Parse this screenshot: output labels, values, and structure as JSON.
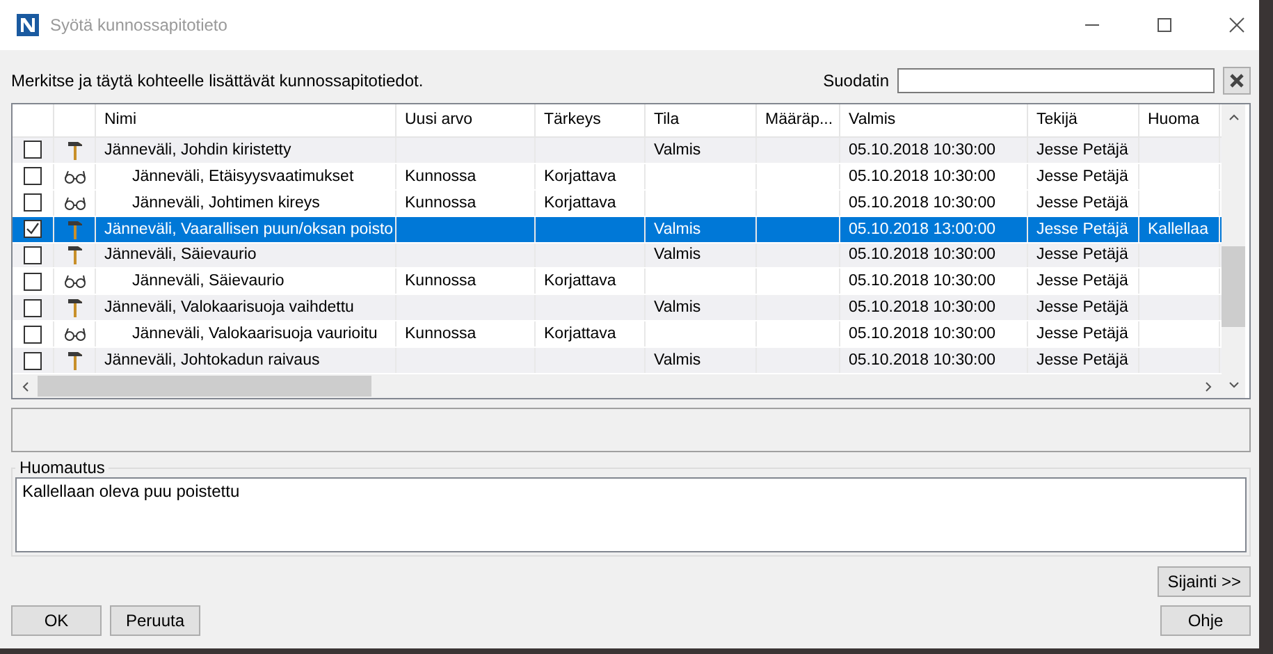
{
  "window": {
    "title": "Syötä kunnossapitotieto"
  },
  "instruction": "Merkitse ja täytä kohteelle lisättävät kunnossapitotiedot.",
  "filter": {
    "label": "Suodatin"
  },
  "table": {
    "columns": [
      "Nimi",
      "Uusi arvo",
      "Tärkeys",
      "Tila",
      "Määräp...",
      "Valmis",
      "Tekijä",
      "Huoma"
    ],
    "rows": [
      {
        "kind": "hammer",
        "checked": false,
        "selected": false,
        "cells": [
          "Jänneväli, Johdin kiristetty",
          "",
          "",
          "Valmis",
          "",
          "05.10.2018 10:30:00",
          "Jesse Petäjä",
          ""
        ],
        "children": [
          {
            "kind": "glasses",
            "checked": false,
            "selected": false,
            "cells": [
              "Jänneväli, Etäisyysvaatimukset",
              "Kunnossa",
              "Korjattava",
              "",
              "",
              "05.10.2018 10:30:00",
              "Jesse Petäjä",
              ""
            ]
          },
          {
            "kind": "glasses",
            "checked": false,
            "selected": false,
            "cells": [
              "Jänneväli, Johtimen kireys",
              "Kunnossa",
              "Korjattava",
              "",
              "",
              "05.10.2018 10:30:00",
              "Jesse Petäjä",
              ""
            ]
          }
        ]
      },
      {
        "kind": "hammer",
        "checked": true,
        "selected": true,
        "cells": [
          "Jänneväli, Vaarallisen puun/oksan poisto",
          "",
          "",
          "Valmis",
          "",
          "05.10.2018 13:00:00",
          "Jesse Petäjä",
          "Kallellaa"
        ]
      },
      {
        "kind": "hammer",
        "checked": false,
        "selected": false,
        "cells": [
          "Jänneväli, Säievaurio",
          "",
          "",
          "Valmis",
          "",
          "05.10.2018 10:30:00",
          "Jesse Petäjä",
          ""
        ],
        "children": [
          {
            "kind": "glasses",
            "checked": false,
            "selected": false,
            "cells": [
              "Jänneväli, Säievaurio",
              "Kunnossa",
              "Korjattava",
              "",
              "",
              "05.10.2018 10:30:00",
              "Jesse Petäjä",
              ""
            ]
          }
        ]
      },
      {
        "kind": "hammer",
        "checked": false,
        "selected": false,
        "cells": [
          "Jänneväli, Valokaarisuoja vaihdettu",
          "",
          "",
          "Valmis",
          "",
          "05.10.2018 10:30:00",
          "Jesse Petäjä",
          ""
        ],
        "children": [
          {
            "kind": "glasses",
            "checked": false,
            "selected": false,
            "cells": [
              "Jänneväli, Valokaarisuoja vaurioitu",
              "Kunnossa",
              "Korjattava",
              "",
              "",
              "05.10.2018 10:30:00",
              "Jesse Petäjä",
              ""
            ]
          }
        ]
      },
      {
        "kind": "hammer",
        "checked": false,
        "selected": false,
        "cells": [
          "Jänneväli, Johtokadun raivaus",
          "",
          "",
          "Valmis",
          "",
          "05.10.2018 10:30:00",
          "Jesse Petäjä",
          ""
        ]
      }
    ]
  },
  "note": {
    "label": "Huomautus",
    "value": "Kallellaan oleva puu poistettu"
  },
  "buttons": {
    "location": "Sijainti >>",
    "ok": "OK",
    "cancel": "Peruuta",
    "help": "Ohje"
  }
}
